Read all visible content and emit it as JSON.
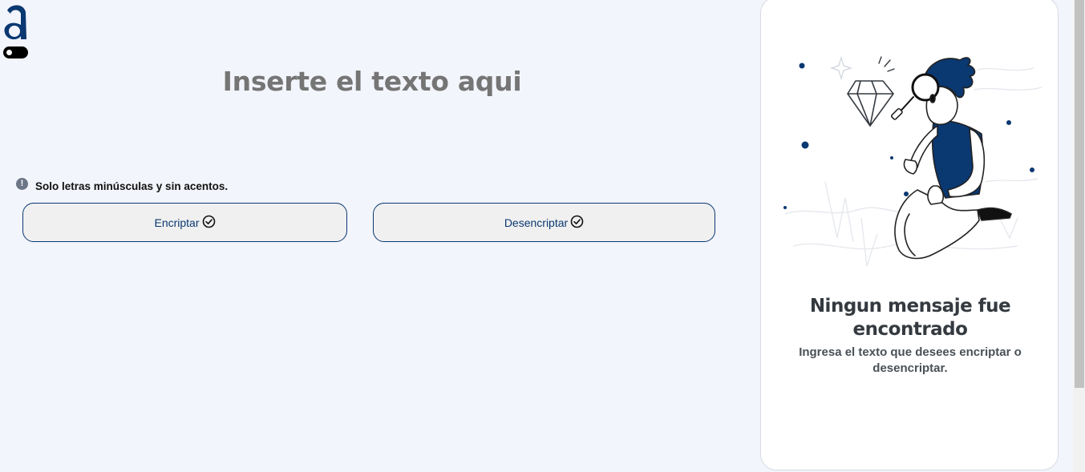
{
  "header": {
    "logo_letter": "a",
    "logo_icon": "alura-logo-icon",
    "theme_toggle_icon": "toggle-switch-icon"
  },
  "input": {
    "placeholder": "Inserte el texto aqui",
    "value": ""
  },
  "notice": {
    "icon": "exclamation-circle-icon",
    "text": "Solo letras minúsculas y sin acentos."
  },
  "buttons": {
    "encrypt_label": "Encriptar",
    "decrypt_label": "Desencriptar",
    "check_icon": "check-circle-icon"
  },
  "result": {
    "illustration": "person-with-magnifier-illustration",
    "title": "Ningun mensaje fue encontrado",
    "subtitle": "Ingresa el texto que desees encriptar o desencriptar."
  },
  "colors": {
    "background": "#f3f5fc",
    "primary": "#0a3871",
    "placeholder": "#7584a4",
    "button_bg": "#f0f0f0"
  }
}
